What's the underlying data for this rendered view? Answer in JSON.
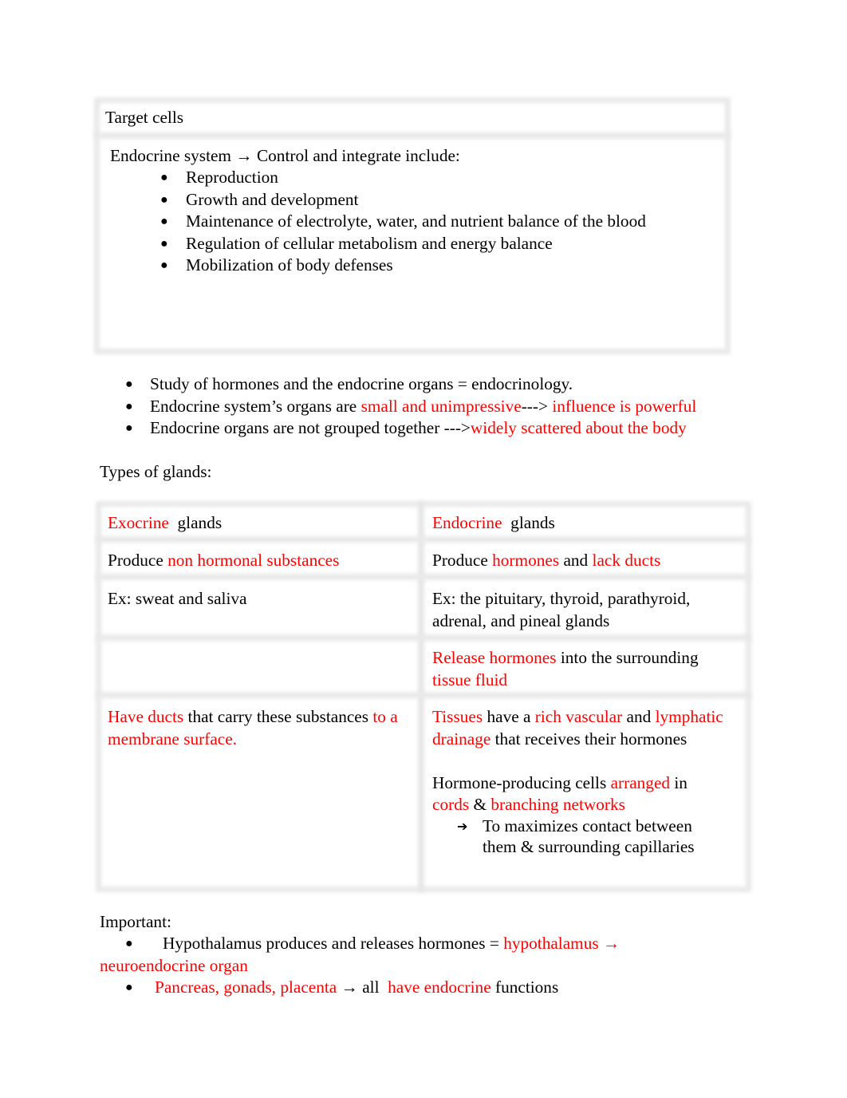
{
  "table1": {
    "header": "Target cells",
    "intro": "Endocrine system → Control and integrate include:",
    "bullet_symbol": "●",
    "items": [
      "Reproduction",
      "Growth and development",
      "Maintenance of electrolyte, water, and nutrient balance of the blood",
      "Regulation of cellular metabolism and energy balance",
      "Mobilization of body defenses"
    ]
  },
  "facts": {
    "bullet_symbol": "●",
    "item1": "Study of hormones and the endocrine organs = endocrinology.",
    "item2": {
      "part1": "Endocrine system’s organs are ",
      "part2_red": "small and unimpressive",
      "part3": "---> ",
      "part4_red": " influence is powerful"
    },
    "item3": {
      "part1": "Endocrine organs are not grouped together --->",
      "part2_red": "widely scattered about the body"
    }
  },
  "types_heading": "Types of glands:",
  "glands_table": {
    "row1": {
      "left_red": "Exocrine",
      "left_black": "  glands",
      "right_red": "Endocrine",
      "right_black": "  glands"
    },
    "row2": {
      "left_black": "Produce ",
      "left_red": "non hormonal substances",
      "right_black1": "Produce ",
      "right_red1": "hormones",
      "right_black2": " and ",
      "right_red2": "lack ducts"
    },
    "row3": {
      "left": "Ex: sweat and saliva",
      "right_line1": "Ex: the pituitary, thyroid, parathyroid,",
      "right_line2": "adrenal, and pineal glands"
    },
    "row4": {
      "left": "",
      "right_red1": "Release hormones",
      "right_black1": " into the surrounding",
      "right_red2": "tissue fluid"
    },
    "row5": {
      "left_red1": "Have ducts",
      "left_black1": " that carry these substances ",
      "left_red2": "to a",
      "left_red3": "membrane surface.",
      "right_p1": {
        "red1": "Tissues",
        "black1": " have a ",
        "red2": "rich vascular",
        "black2": " and ",
        "red3": "lymphatic",
        "red4": "drainage",
        "black3": " that receives their hormones"
      },
      "right_p2": {
        "black1": "Hormone-producing cells ",
        "red1": "arranged",
        "black2": " in",
        "red2": "cords",
        "black3": " & ",
        "red3": "branching networks"
      },
      "arrow_symbol": "➔",
      "arrow_line1": "To maximizes contact between",
      "arrow_line2": "them & surrounding capillaries"
    }
  },
  "important": {
    "heading": "Important:",
    "bullet_symbol": "●",
    "item1": {
      "black": "Hypothalamus produces and releases hormones = ",
      "red1": "hypothalamus →",
      "red2": "neuroendocrine organ"
    },
    "item2": {
      "red1": "Pancreas, gonads, placenta",
      "black1": " → all  ",
      "red2": "have endocrine",
      "black2": " functions"
    }
  },
  "colors": {
    "text": "#000000",
    "highlight_red": "#ff0000",
    "table_border": "#e9e9e9"
  }
}
